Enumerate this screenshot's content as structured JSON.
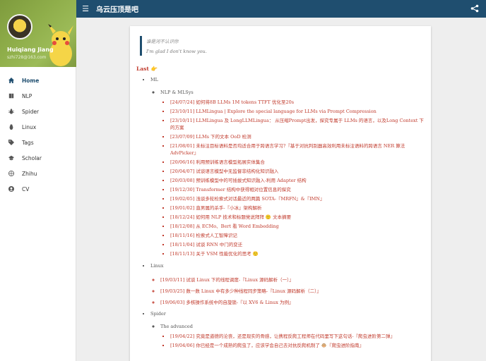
{
  "header": {
    "title": "乌云压顶是吧",
    "colors": {
      "bar": "#1f4e6f",
      "accent": "#c0392b"
    }
  },
  "profile": {
    "name": "Huiqiang Jiang",
    "email": "szhi728@163.com"
  },
  "nav": [
    {
      "label": "Home",
      "icon": "home-icon",
      "active": true
    },
    {
      "label": "NLP",
      "icon": "book-icon",
      "active": false
    },
    {
      "label": "Spider",
      "icon": "bug-icon",
      "active": false
    },
    {
      "label": "Linux",
      "icon": "linux-icon",
      "active": false
    },
    {
      "label": "Tags",
      "icon": "tags-icon",
      "active": false
    },
    {
      "label": "Scholar",
      "icon": "graduation-cap-icon",
      "active": false
    },
    {
      "label": "Zhihu",
      "icon": "globe-icon",
      "active": false
    },
    {
      "label": "CV",
      "icon": "user-icon",
      "active": false
    }
  ],
  "quote": {
    "line1": "谁是河不认识你",
    "line2": "I'm glad I don't know you."
  },
  "last": {
    "label": "Last",
    "emoji": "👉"
  },
  "sections": {
    "ml": {
      "label": "ML",
      "sub": {
        "label": "NLP & MLSys",
        "items": [
          "[24/07/24] 如何将8B LLMs 1M tokens TTFT 优化至20s",
          "[23/10/11] LLMLingua | Explore the special language for LLMs via Prompt Compression",
          "[23/10/11] LLMLingua 及 LongLLMLingua： 从压缩Prompt出发，探究专属于 LLMs 的语言，以及Long Context 下的方案",
          "[23/07/09] LLMs 下的文本 OoD 检测",
          "[21/08/01] 未标注目标语料是否均适合用于跨语言学习?『基于对抗判别器高效利用未标注语料的跨语言 NER 算法 AdvPicker』",
          "[20/06/16] 利用预训练语言模型拓展实体集合",
          "[20/04/07] 试谈语言模型中无监督非结构化知识融入",
          "[20/03/08] 预训练模型中的可插拔式知识融入-利用 Adapter 结构",
          "[19/12/30] Transformer 结构中获得相对位置信息的探究",
          "[19/02/05] 浅谈多轮检索式对话最近的两篇 SOTA-『MRFN』&『IMN』",
          "[19/01/02] 直男属的杀手-『小冰』架构解析",
          "[18/12/24] 如何用 NLP 技术和标题党说拜拜 🙂 文本摘要",
          "[18/12/08] 从 ECMo、Bert 看 Word Embedding",
          "[18/11/16] 检索式人工智障识记",
          "[18/11/04] 试谈 RNN 中门的变迁",
          "[18/11/13] 关于 VSM 性能优化的思考 🙂"
        ]
      }
    },
    "linux": {
      "label": "Linux",
      "items": [
        "[19/03/11] 试谈 Linux 下的线程调度-『Linux 源码解析（一）』",
        "[19/03/25] 数一数 Linux 中有多少种线程同步策略-『Linux 源码解析（二）』",
        "[19/06/03] 多核操作系统中的自旋锁-『以 XV6 & Linux 为例』"
      ]
    },
    "spider": {
      "label": "Spider",
      "sub": {
        "label": "The advanced",
        "items": [
          "[19/04/22] 究竟是道德的沦丧，还是现实的骨感，让携程反爬工程师在代码里写下这句话-『爬虫进阶第二弹』",
          "[19/04/06] 你已经是一个成熟的爬虫了，应该学会自己去对抗反爬机制了 🐵『爬虫进阶指南』"
        ]
      }
    }
  }
}
